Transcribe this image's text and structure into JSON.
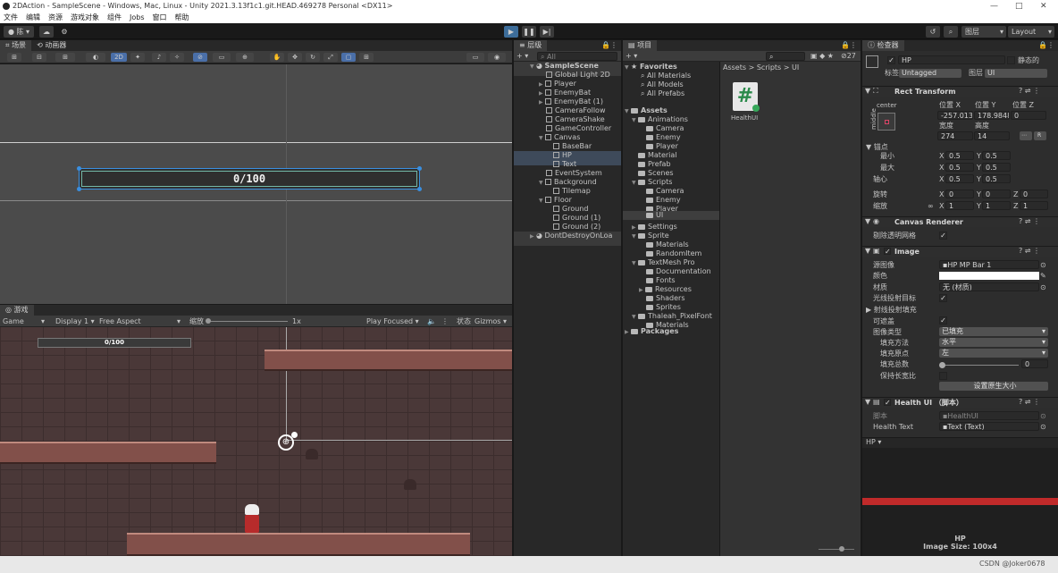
{
  "title_bar": {
    "text": "2DAction - SampleScene - Windows, Mac, Linux - Unity 2021.3.13f1c1.git.HEAD.469278 Personal <DX11>"
  },
  "menu": [
    "文件",
    "编辑",
    "资源",
    "游戏对象",
    "组件",
    "Jobs",
    "窗口",
    "帮助"
  ],
  "toolbar": {
    "account": "陈",
    "layers": "图层",
    "layout": "Layout"
  },
  "scene_panel": {
    "tab_scene": "场景",
    "tab_animator": "动画器",
    "btn_2d": "2D",
    "hp_text": "0/100"
  },
  "game_panel": {
    "tab": "游戏",
    "display_mode": "Game",
    "display": "Display 1",
    "aspect": "Free Aspect",
    "scale_label": "缩放",
    "scale_value": "1x",
    "play_mode": "Play Focused",
    "stats": "状态",
    "gizmos": "Gizmos",
    "hp_text": "0/100"
  },
  "hierarchy": {
    "tab": "层级",
    "search": "All",
    "items": [
      "SampleScene",
      "Global Light 2D",
      "Player",
      "EnemyBat",
      "EnemyBat (1)",
      "CameraFollow",
      "CameraShake",
      "GameController",
      "Canvas",
      "BaseBar",
      "HP",
      "Text",
      "EventSystem",
      "Background",
      "Tilemap",
      "Floor",
      "Ground",
      "Ground (1)",
      "Ground (2)",
      "DontDestroyOnLoa"
    ]
  },
  "project": {
    "tab": "项目",
    "favorites": [
      "Favorites",
      "All Materials",
      "All Models",
      "All Prefabs"
    ],
    "tree": [
      "Assets",
      "Animations",
      "Camera",
      "Enemy",
      "Player",
      "Material",
      "Prefab",
      "Scenes",
      "Scripts",
      "Camera",
      "Enemy",
      "Player",
      "UI",
      "Settings",
      "Sprite",
      "Materials",
      "RandomItem",
      "TextMesh Pro",
      "Documentation",
      "Fonts",
      "Resources",
      "Shaders",
      "Sprites",
      "Thaleah_PixelFont",
      "Materials",
      "Packages"
    ],
    "breadcrumb": [
      "Assets",
      "Scripts",
      "UI"
    ],
    "asset": "HealthUI",
    "count": "27"
  },
  "inspector": {
    "tab": "检查器",
    "name": "HP",
    "static": "静态的",
    "tag_label": "标签",
    "tag": "Untagged",
    "layer_label": "图层",
    "layer": "UI",
    "rect": {
      "title": "Rect Transform",
      "anchor_h": "center",
      "anchor_v": "middle",
      "pos_x_label": "位置 X",
      "pos_y_label": "位置 Y",
      "pos_z_label": "位置 Z",
      "pos_x": "-257.0136",
      "pos_y": "178.9848",
      "pos_z": "0",
      "w_label": "宽度",
      "h_label": "高度",
      "width": "274",
      "height": "14",
      "r_label": "R",
      "anchors_label": "锚点",
      "min_label": "最小",
      "max_label": "最大",
      "pivot_label": "轴心",
      "rot_label": "旋转",
      "scale_label": "缩放",
      "min_x": "0.5",
      "min_y": "0.5",
      "max_x": "0.5",
      "max_y": "0.5",
      "pivot_x": "0.5",
      "pivot_y": "0.5",
      "rot_x": "0",
      "rot_y": "0",
      "rot_z": "0",
      "scale_x": "1",
      "scale_y": "1",
      "scale_z": "1",
      "x": "X",
      "y": "Y",
      "z": "Z"
    },
    "canvas_renderer": {
      "title": "Canvas Renderer",
      "cull": "剔除透明网格"
    },
    "image": {
      "title": "Image",
      "source_label": "源图像",
      "source": "HP MP Bar 1",
      "color_label": "颜色",
      "material_label": "材质",
      "material": "无 (材质)",
      "raycast_target": "光线投射目标",
      "raycast_padding": "射线投射填充",
      "maskable": "可遮盖",
      "type_label": "图像类型",
      "type": "已填充",
      "fill_method_label": "填充方法",
      "fill_method": "水平",
      "fill_origin_label": "填充原点",
      "fill_origin": "左",
      "fill_amount_label": "填充总数",
      "fill_amount": "0",
      "preserve_label": "保持长宽比",
      "native_size": "设置原生大小"
    },
    "script": {
      "title": "Health UI （脚本）",
      "script_label": "脚本",
      "script": "HealthUI",
      "health_text_label": "Health Text",
      "health_text": "Text (Text)"
    },
    "preview": {
      "label": "HP ▾",
      "name": "HP",
      "size": "Image Size: 100x4"
    }
  },
  "watermark": "CSDN @Joker0678",
  "colors": {
    "bar_red": "#c02a2a",
    "bg_brick": "#4a3838"
  }
}
